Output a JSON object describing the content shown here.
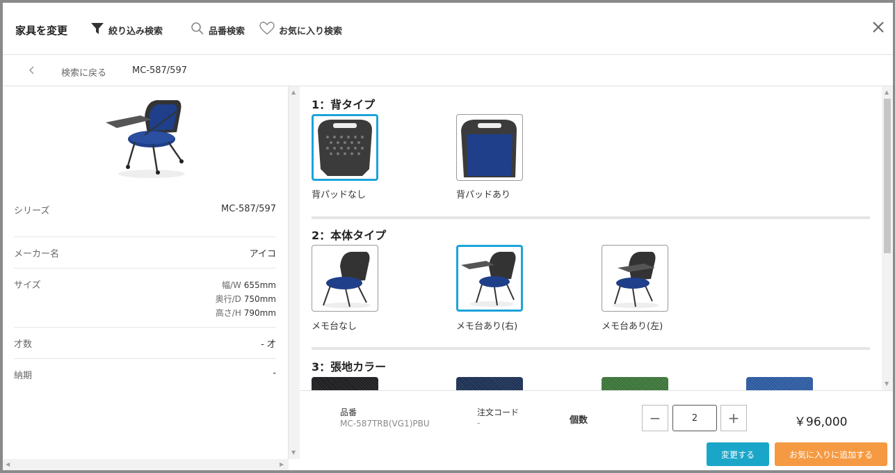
{
  "header": {
    "title": "家具を変更",
    "filter_label": "絞り込み検索",
    "code_search_label": "品番検索",
    "favorite_search_label": "お気に入り検索"
  },
  "breadcrumb": {
    "back_label": "検索に戻る",
    "current": "MC-587/597"
  },
  "specs": {
    "series_label": "シリーズ",
    "series_value": "MC-587/597",
    "maker_label": "メーカー名",
    "maker_value": "アイコ",
    "size_label": "サイズ",
    "width_label": "幅/W",
    "width_value": "655mm",
    "depth_label": "奥行/D",
    "depth_value": "750mm",
    "height_label": "高さ/H",
    "height_value": "790mm",
    "volume_label": "才数",
    "volume_value": "- 才",
    "delivery_label": "納期",
    "delivery_value": "-"
  },
  "sections": [
    {
      "title": "1：背タイプ",
      "options": [
        {
          "label": "背パッドなし",
          "selected": true
        },
        {
          "label": "背パッドあり",
          "selected": false
        }
      ]
    },
    {
      "title": "2：本体タイプ",
      "options": [
        {
          "label": "メモ台なし",
          "selected": false
        },
        {
          "label": "メモ台あり(右)",
          "selected": true
        },
        {
          "label": "メモ台あり(左)",
          "selected": false
        }
      ]
    },
    {
      "title": "3：張地カラー",
      "swatches": [
        "#1f1f22",
        "#1e3358",
        "#3f7a3c",
        "#2f5fa8"
      ]
    }
  ],
  "footer": {
    "code_label": "品番",
    "code_value": "MC-587TRB(VG1)PBU",
    "order_label": "注文コード",
    "order_value": "-",
    "qty_label": "個数",
    "qty_value": "2",
    "minus": "−",
    "plus": "+",
    "price": "￥96,000",
    "change_button": "変更する",
    "favorite_button": "お気に入りに追加する"
  },
  "colors": {
    "accent": "#1ba3d9",
    "change_button": "#1aa6c9",
    "favorite_button": "#f59a42",
    "seat_blue": "#1f3f8a"
  }
}
